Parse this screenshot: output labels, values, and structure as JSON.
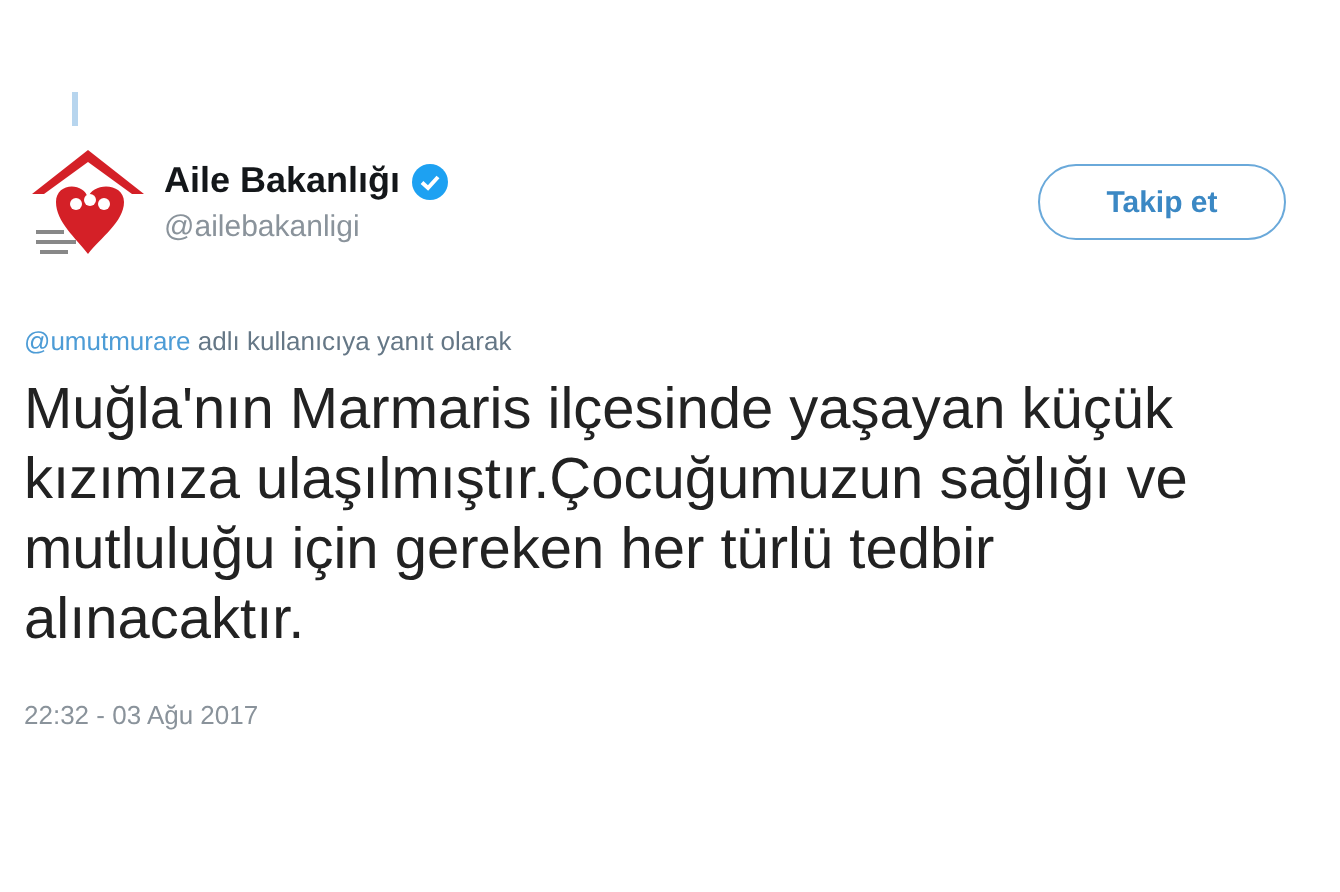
{
  "account": {
    "name": "Aile Bakanlığı",
    "verified": true,
    "handle": "@ailebakanligi"
  },
  "follow_button": {
    "label": "Takip et"
  },
  "reply_to": {
    "user": "@umutmurare",
    "text": "adlı kullanıcıya yanıt olarak"
  },
  "tweet": {
    "lines": [
      "Muğla'nın Marmaris ilçesinde yaşayan küçük",
      "kızımıza ulaşılmıştır.Çocuğumuzun sağlığı ve",
      "mutluluğu için gereken her türlü tedbir",
      "alınacaktır."
    ]
  },
  "timestamp": "22:32 - 03 Ağu 2017"
}
